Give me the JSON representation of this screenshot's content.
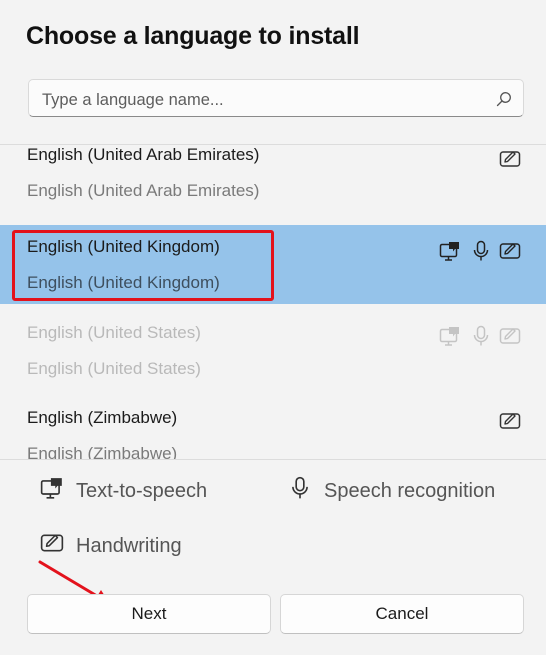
{
  "dialog": {
    "title": "Choose a language to install"
  },
  "search": {
    "placeholder": "Type a language name...",
    "icon": "search-icon"
  },
  "languages": [
    {
      "name": "English (United Arab Emirates)",
      "native": "English (United Arab Emirates)",
      "features": [
        "handwriting"
      ],
      "state": "normal"
    },
    {
      "name": "English (United Kingdom)",
      "native": "English (United Kingdom)",
      "features": [
        "text-to-speech",
        "speech-recognition",
        "handwriting"
      ],
      "state": "selected"
    },
    {
      "name": "English (United States)",
      "native": "English (United States)",
      "features": [
        "text-to-speech",
        "speech-recognition",
        "handwriting"
      ],
      "state": "disabled"
    },
    {
      "name": "English (Zimbabwe)",
      "native": "English (Zimbabwe)",
      "features": [
        "handwriting"
      ],
      "state": "normal"
    }
  ],
  "legend": {
    "tts": "Text-to-speech",
    "speech": "Speech recognition",
    "handwriting": "Handwriting"
  },
  "buttons": {
    "next": "Next",
    "cancel": "Cancel"
  },
  "colors": {
    "selected_bg": "#95c3ea",
    "annotation": "#e3121c"
  }
}
